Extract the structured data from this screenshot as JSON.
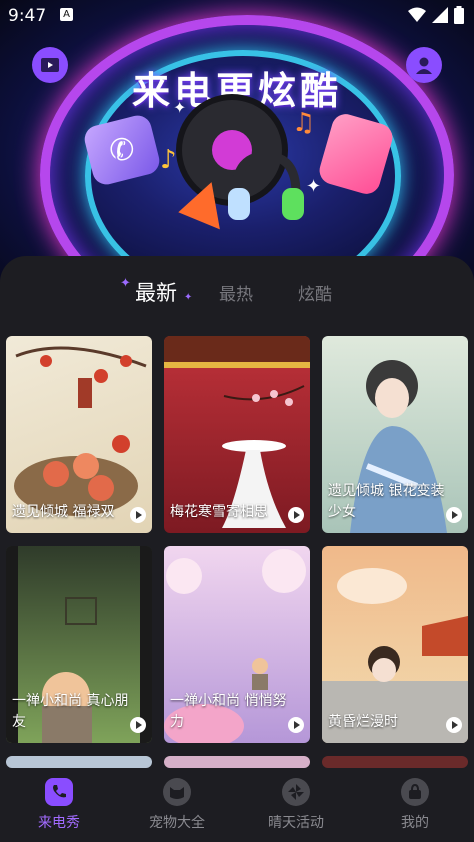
{
  "status": {
    "time": "9:47",
    "a_badge": "A"
  },
  "hero": {
    "title": "来电更炫酷",
    "video_icon": "video-icon",
    "profile_icon": "user-icon"
  },
  "tabs": [
    {
      "label": "最新",
      "active": true
    },
    {
      "label": "最热",
      "active": false
    },
    {
      "label": "炫酷",
      "active": false
    }
  ],
  "cards": [
    {
      "caption": "遗见倾城 福禄双",
      "bg": "#e9e1cc"
    },
    {
      "caption": "梅花寒雪寄相思",
      "bg": "#a5262c"
    },
    {
      "caption": "遗见倾城 银花变装少女",
      "bg": "#c9dcc9"
    },
    {
      "caption": "一禅小和尚 真心朋友",
      "bg": "#6b8e4e"
    },
    {
      "caption": "一禅小和尚 悄悄努力",
      "bg": "#d7b6dc"
    },
    {
      "caption": "黄昏烂漫时",
      "bg": "#e79a70"
    }
  ],
  "nav": [
    {
      "label": "来电秀",
      "icon": "phone-icon",
      "active": true
    },
    {
      "label": "宠物大全",
      "icon": "pet-icon",
      "active": false
    },
    {
      "label": "晴天活动",
      "icon": "pinwheel-icon",
      "active": false
    },
    {
      "label": "我的",
      "icon": "bag-icon",
      "active": false
    }
  ],
  "colors": {
    "accent": "#8a4dff",
    "background": "#1d1d22"
  }
}
